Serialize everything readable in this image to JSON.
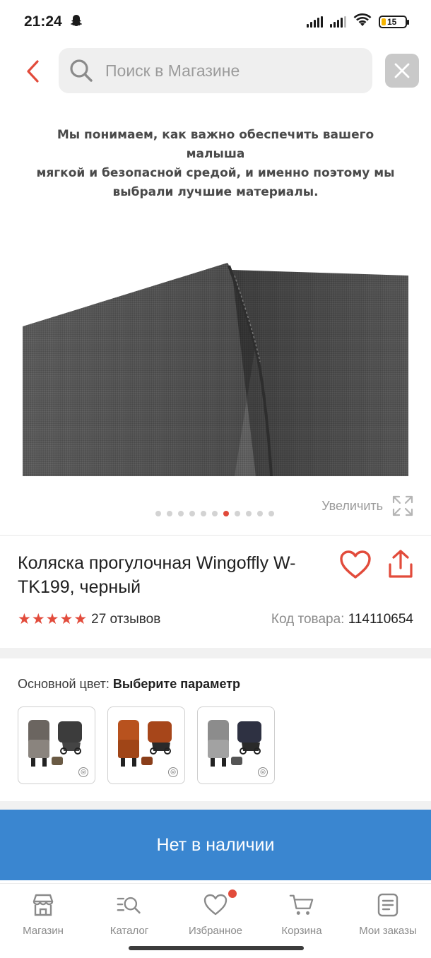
{
  "status_bar": {
    "time": "21:24",
    "battery": "15",
    "battery_color": "#f5b400"
  },
  "header": {
    "search_placeholder": "Поиск в Магазине",
    "back_icon": "chevron-left-icon",
    "close_icon": "close-icon",
    "accent_color": "#e24b3b"
  },
  "gallery": {
    "caption": "Мы понимаем, как важно обеспечить вашего малыша мягкой и безопасной средой, и именно поэтому мы выбрали лучшие материалы.",
    "caption_lines": [
      "Мы понимаем, как важно обеспечить вашего малыша",
      "мягкой и безопасной средой, и именно поэтому мы",
      "выбрали лучшие материалы."
    ],
    "dots_total": 11,
    "active_dot": 7,
    "zoom_label": "Увеличить"
  },
  "product": {
    "title": "Коляска прогулочная Wingoffly W-TK199, черный",
    "rating": 5,
    "reviews": "27 отзывов",
    "sku_label": "Код товара:",
    "sku_value": "114110654"
  },
  "options": {
    "label": "Основной цвет:",
    "value": "Выберите параметр",
    "swatches": [
      {
        "name": "gray",
        "color": "#6b6560"
      },
      {
        "name": "orange",
        "color": "#b8521e"
      },
      {
        "name": "light-gray",
        "color": "#8c8c8c"
      }
    ]
  },
  "buy_button": {
    "label": "Нет в наличии",
    "color": "#3a86d0"
  },
  "bottom_nav": [
    {
      "label": "Магазин",
      "icon": "store-icon"
    },
    {
      "label": "Каталог",
      "icon": "catalog-search-icon"
    },
    {
      "label": "Избранное",
      "icon": "heart-icon",
      "badge": true
    },
    {
      "label": "Корзина",
      "icon": "cart-icon"
    },
    {
      "label": "Мои заказы",
      "icon": "orders-icon"
    }
  ]
}
